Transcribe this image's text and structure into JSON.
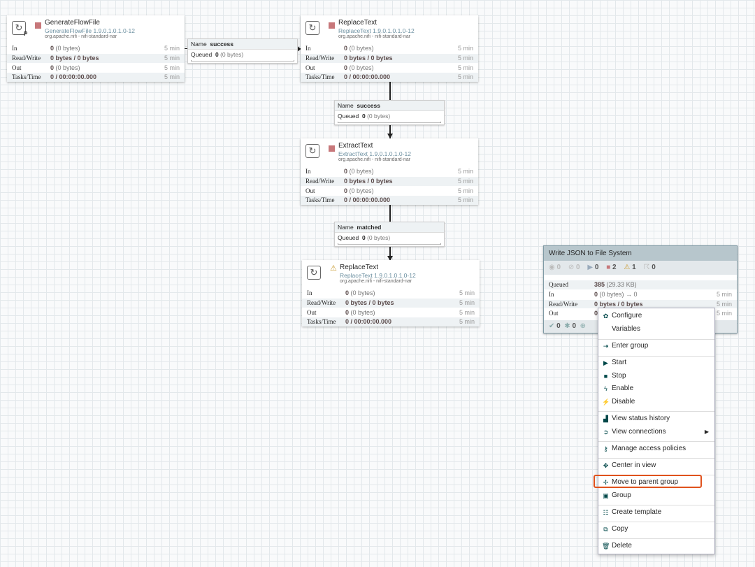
{
  "processors": [
    {
      "name": "GenerateFlowFile",
      "type": "GenerateFlowFile 1.9.0.1.0.1.0-12",
      "bundle": "org.apache.nifi - nifi-standard-nar",
      "badge": "P",
      "state": "stopped",
      "in": "0",
      "in_detail": "(0 bytes)",
      "rw": "0 bytes / 0 bytes",
      "out": "0",
      "out_detail": "(0 bytes)",
      "tasks": "0 / 00:00:00.000",
      "window": "5 min"
    },
    {
      "name": "ReplaceText",
      "type": "ReplaceText 1.9.0.1.0.1.0-12",
      "bundle": "org.apache.nifi - nifi-standard-nar",
      "badge": "",
      "state": "stopped",
      "in": "0",
      "in_detail": "(0 bytes)",
      "rw": "0 bytes / 0 bytes",
      "out": "0",
      "out_detail": "(0 bytes)",
      "tasks": "0 / 00:00:00.000",
      "window": "5 min"
    },
    {
      "name": "ExtractText",
      "type": "ExtractText 1.9.0.1.0.1.0-12",
      "bundle": "org.apache.nifi - nifi-standard-nar",
      "badge": "",
      "state": "stopped",
      "in": "0",
      "in_detail": "(0 bytes)",
      "rw": "0 bytes / 0 bytes",
      "out": "0",
      "out_detail": "(0 bytes)",
      "tasks": "0 / 00:00:00.000",
      "window": "5 min"
    },
    {
      "name": "ReplaceText",
      "type": "ReplaceText 1.9.0.1.0.1.0-12",
      "bundle": "org.apache.nifi - nifi-standard-nar",
      "badge": "",
      "state": "invalid",
      "in": "0",
      "in_detail": "(0 bytes)",
      "rw": "0 bytes / 0 bytes",
      "out": "0",
      "out_detail": "(0 bytes)",
      "tasks": "0 / 00:00:00.000",
      "window": "5 min"
    }
  ],
  "labels": {
    "in": "In",
    "rw": "Read/Write",
    "out": "Out",
    "tasks": "Tasks/Time",
    "name": "Name",
    "queued": "Queued",
    "queued_pg": "Queued"
  },
  "connections": [
    {
      "name": "success",
      "queued": "0",
      "queued_detail": "(0 bytes)"
    },
    {
      "name": "success",
      "queued": "0",
      "queued_detail": "(0 bytes)"
    },
    {
      "name": "matched",
      "queued": "0",
      "queued_detail": "(0 bytes)"
    }
  ],
  "process_group": {
    "title": "Write JSON to File System",
    "stats": {
      "transmitting": "0",
      "not_transmitting": "0",
      "running": "0",
      "stopped": "2",
      "invalid": "1",
      "disabled": "0"
    },
    "queued": "385",
    "queued_detail": "(29.33 KB)",
    "in": "0",
    "in_detail": "(0 bytes) → 0",
    "rw": "0 bytes / 0 bytes",
    "out": "0",
    "window": "5 min",
    "footer": {
      "up_to_date": "0",
      "locally_modified": "0"
    }
  },
  "context_menu": [
    {
      "label": "Configure",
      "icon": "gear-icon",
      "glyph": "✿"
    },
    {
      "label": "Variables",
      "icon": "",
      "glyph": ""
    },
    {
      "label": "Enter group",
      "icon": "enter-icon",
      "glyph": "⇥"
    },
    {
      "label": "Start",
      "icon": "play-icon",
      "glyph": "▶"
    },
    {
      "label": "Stop",
      "icon": "stop-icon",
      "glyph": "■"
    },
    {
      "label": "Enable",
      "icon": "bolt-icon",
      "glyph": "ϟ"
    },
    {
      "label": "Disable",
      "icon": "disable-icon",
      "glyph": "⚡"
    },
    {
      "label": "View status history",
      "icon": "chart-icon",
      "glyph": "▟"
    },
    {
      "label": "View connections",
      "icon": "connections-icon",
      "glyph": "➲"
    },
    {
      "label": "Manage access policies",
      "icon": "key-icon",
      "glyph": "⚷"
    },
    {
      "label": "Center in view",
      "icon": "crosshair-icon",
      "glyph": "✥"
    },
    {
      "label": "Move to parent group",
      "icon": "move-icon",
      "glyph": "✢"
    },
    {
      "label": "Group",
      "icon": "group-icon",
      "glyph": "▣"
    },
    {
      "label": "Create template",
      "icon": "template-icon",
      "glyph": "☷"
    },
    {
      "label": "Copy",
      "icon": "copy-icon",
      "glyph": "⧉"
    },
    {
      "label": "Delete",
      "icon": "trash-icon",
      "glyph": "🗑"
    }
  ],
  "colors": {
    "highlight": "#e0521d",
    "stopped": "#c7777a",
    "warning": "#c99a2e"
  }
}
